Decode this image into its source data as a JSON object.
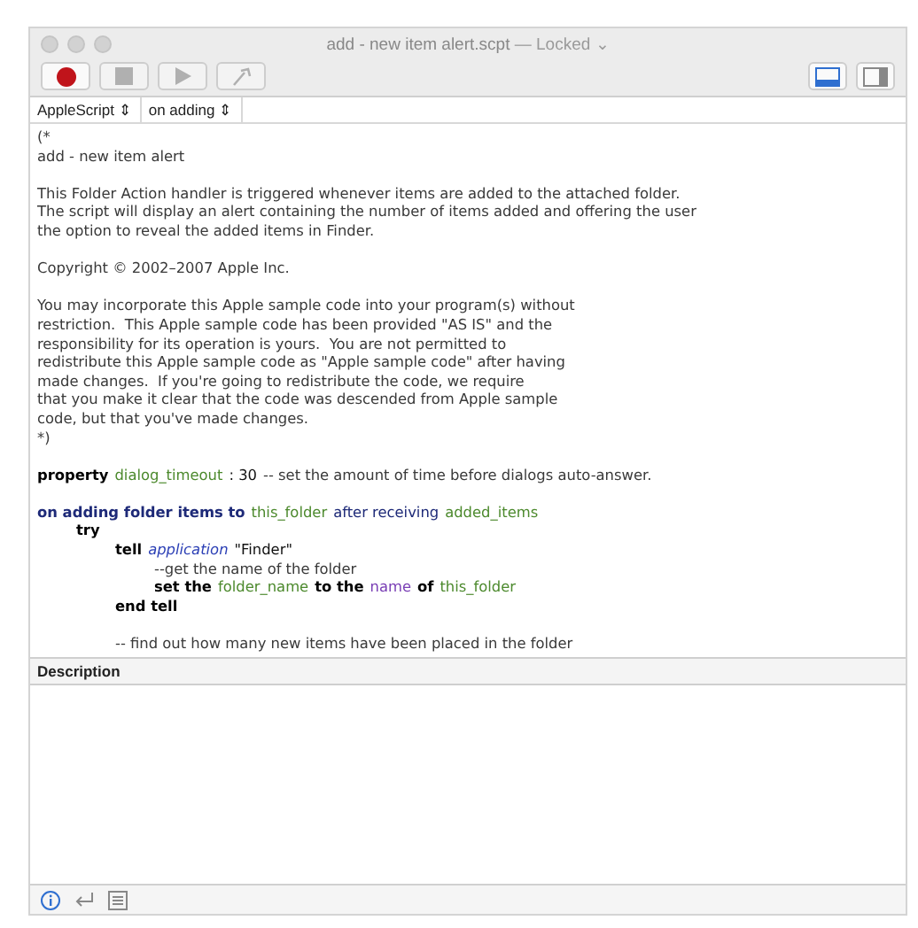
{
  "window": {
    "title": "add - new item alert.scpt",
    "separator": "—",
    "status": "Locked ⌄"
  },
  "toolbar": {
    "buttons": [
      {
        "kind": "record",
        "disabled": false
      },
      {
        "kind": "stop",
        "disabled": true
      },
      {
        "kind": "run",
        "disabled": true
      },
      {
        "kind": "compile",
        "disabled": true
      }
    ],
    "view_buttons": [
      {
        "kind": "bottom",
        "selected": true
      },
      {
        "kind": "side",
        "selected": false
      }
    ]
  },
  "navigation_bar": {
    "language": "AppleScript ⇕",
    "handler": "on adding ⇕"
  },
  "script": [
    {
      "lines": [
        {
          "tokens": [
            {
              "kind": "comment",
              "text": "(*"
            }
          ]
        },
        {
          "tokens": [
            {
              "kind": "comment",
              "text": "add - new item alert"
            }
          ]
        }
      ]
    },
    {
      "lines": [
        {
          "tokens": [
            {
              "kind": "comment",
              "text": "This Folder Action handler is triggered whenever items are added to the attached folder."
            }
          ]
        },
        {
          "tokens": [
            {
              "kind": "comment",
              "text": "The script will display an alert containing the number of items added and offering the user"
            }
          ]
        },
        {
          "tokens": [
            {
              "kind": "comment",
              "text": "the option to reveal the added items in Finder."
            }
          ]
        }
      ]
    },
    {
      "lines": [
        {
          "tokens": [
            {
              "kind": "comment",
              "text": "Copyright © 2002–2007 Apple Inc."
            }
          ]
        }
      ]
    },
    {
      "lines": [
        {
          "tokens": [
            {
              "kind": "comment",
              "text": "You may incorporate this Apple sample code into your program(s) without"
            }
          ]
        },
        {
          "tokens": [
            {
              "kind": "comment",
              "text": "restriction.  This Apple sample code has been provided \"AS IS\" and the"
            }
          ]
        },
        {
          "tokens": [
            {
              "kind": "comment",
              "text": "responsibility for its operation is yours.  You are not permitted to"
            }
          ]
        },
        {
          "tokens": [
            {
              "kind": "comment",
              "text": "redistribute this Apple sample code as \"Apple sample code\" after having"
            }
          ]
        },
        {
          "tokens": [
            {
              "kind": "comment",
              "text": "made changes.  If you're going to redistribute the code, we require"
            }
          ]
        },
        {
          "tokens": [
            {
              "kind": "comment",
              "text": "that you make it clear that the code was descended from Apple sample"
            }
          ]
        },
        {
          "tokens": [
            {
              "kind": "comment",
              "text": "code, but that you've made changes."
            }
          ]
        },
        {
          "tokens": [
            {
              "kind": "comment",
              "text": "*)"
            }
          ]
        }
      ]
    },
    {
      "lines": [
        {
          "tokens": [
            {
              "kind": "keyword",
              "text": "property"
            },
            {
              "kind": "variable",
              "text": "dialog_timeout"
            },
            {
              "kind": "plain",
              "text": ": 30"
            },
            {
              "kind": "comment",
              "text": "-- set the amount of time before dialogs auto-answer."
            }
          ]
        }
      ]
    },
    {
      "lines": [
        {
          "tokens": [
            {
              "kind": "handler",
              "text": "on adding folder items to"
            },
            {
              "kind": "variable",
              "text": "this_folder"
            },
            {
              "kind": "param",
              "text": "after receiving"
            },
            {
              "kind": "variable",
              "text": "added_items"
            }
          ],
          "children": [
            {
              "tokens": [
                {
                  "kind": "keyword",
                  "text": "try"
                }
              ],
              "children": [
                {
                  "tokens": [
                    {
                      "kind": "keyword",
                      "text": "tell"
                    },
                    {
                      "kind": "class",
                      "text": "application"
                    },
                    {
                      "kind": "plain",
                      "text": "\"Finder\""
                    }
                  ],
                  "children": [
                    {
                      "tokens": [
                        {
                          "kind": "comment",
                          "text": "--get the name of the folder"
                        }
                      ]
                    },
                    {
                      "tokens": [
                        {
                          "kind": "keyword",
                          "text": "set the"
                        },
                        {
                          "kind": "variable",
                          "text": "folder_name"
                        },
                        {
                          "kind": "keyword",
                          "text": "to the"
                        },
                        {
                          "kind": "property",
                          "text": "name"
                        },
                        {
                          "kind": "keyword",
                          "text": "of"
                        },
                        {
                          "kind": "variable",
                          "text": "this_folder"
                        }
                      ]
                    }
                  ]
                },
                {
                  "tokens": [
                    {
                      "kind": "keyword",
                      "text": "end tell"
                    }
                  ]
                },
                {
                  "gap_before": true,
                  "tokens": [
                    {
                      "kind": "comment",
                      "text": "-- find out how many new items have been placed in the folder"
                    }
                  ]
                }
              ]
            }
          ]
        }
      ]
    }
  ],
  "description_pane": {
    "title": "Description"
  },
  "bottom_bar": {
    "buttons": [
      {
        "kind": "info",
        "selected": true
      },
      {
        "kind": "return",
        "selected": false
      },
      {
        "kind": "log",
        "selected": false
      }
    ]
  }
}
